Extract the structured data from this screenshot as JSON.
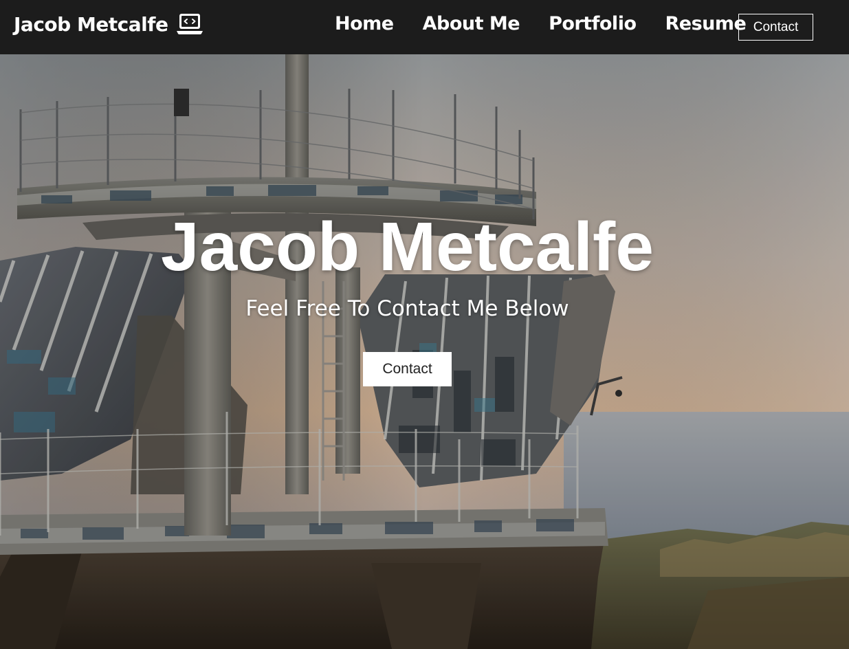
{
  "navbar": {
    "brand": "Jacob Metcalfe",
    "brand_icon": "laptop-code-icon",
    "links": [
      "Home",
      "About Me",
      "Portfolio",
      "Resume"
    ],
    "contact_button": "Contact"
  },
  "hero": {
    "title": "Jacob Metcalfe",
    "subtitle": "Feel Free To Contact Me Below",
    "contact_button": "Contact",
    "background": "photo-abandoned-observation-tower"
  },
  "colors": {
    "navbar_bg": "#1c1c1c",
    "text": "#ffffff",
    "button_bg": "#ffffff",
    "button_text": "#222222"
  }
}
